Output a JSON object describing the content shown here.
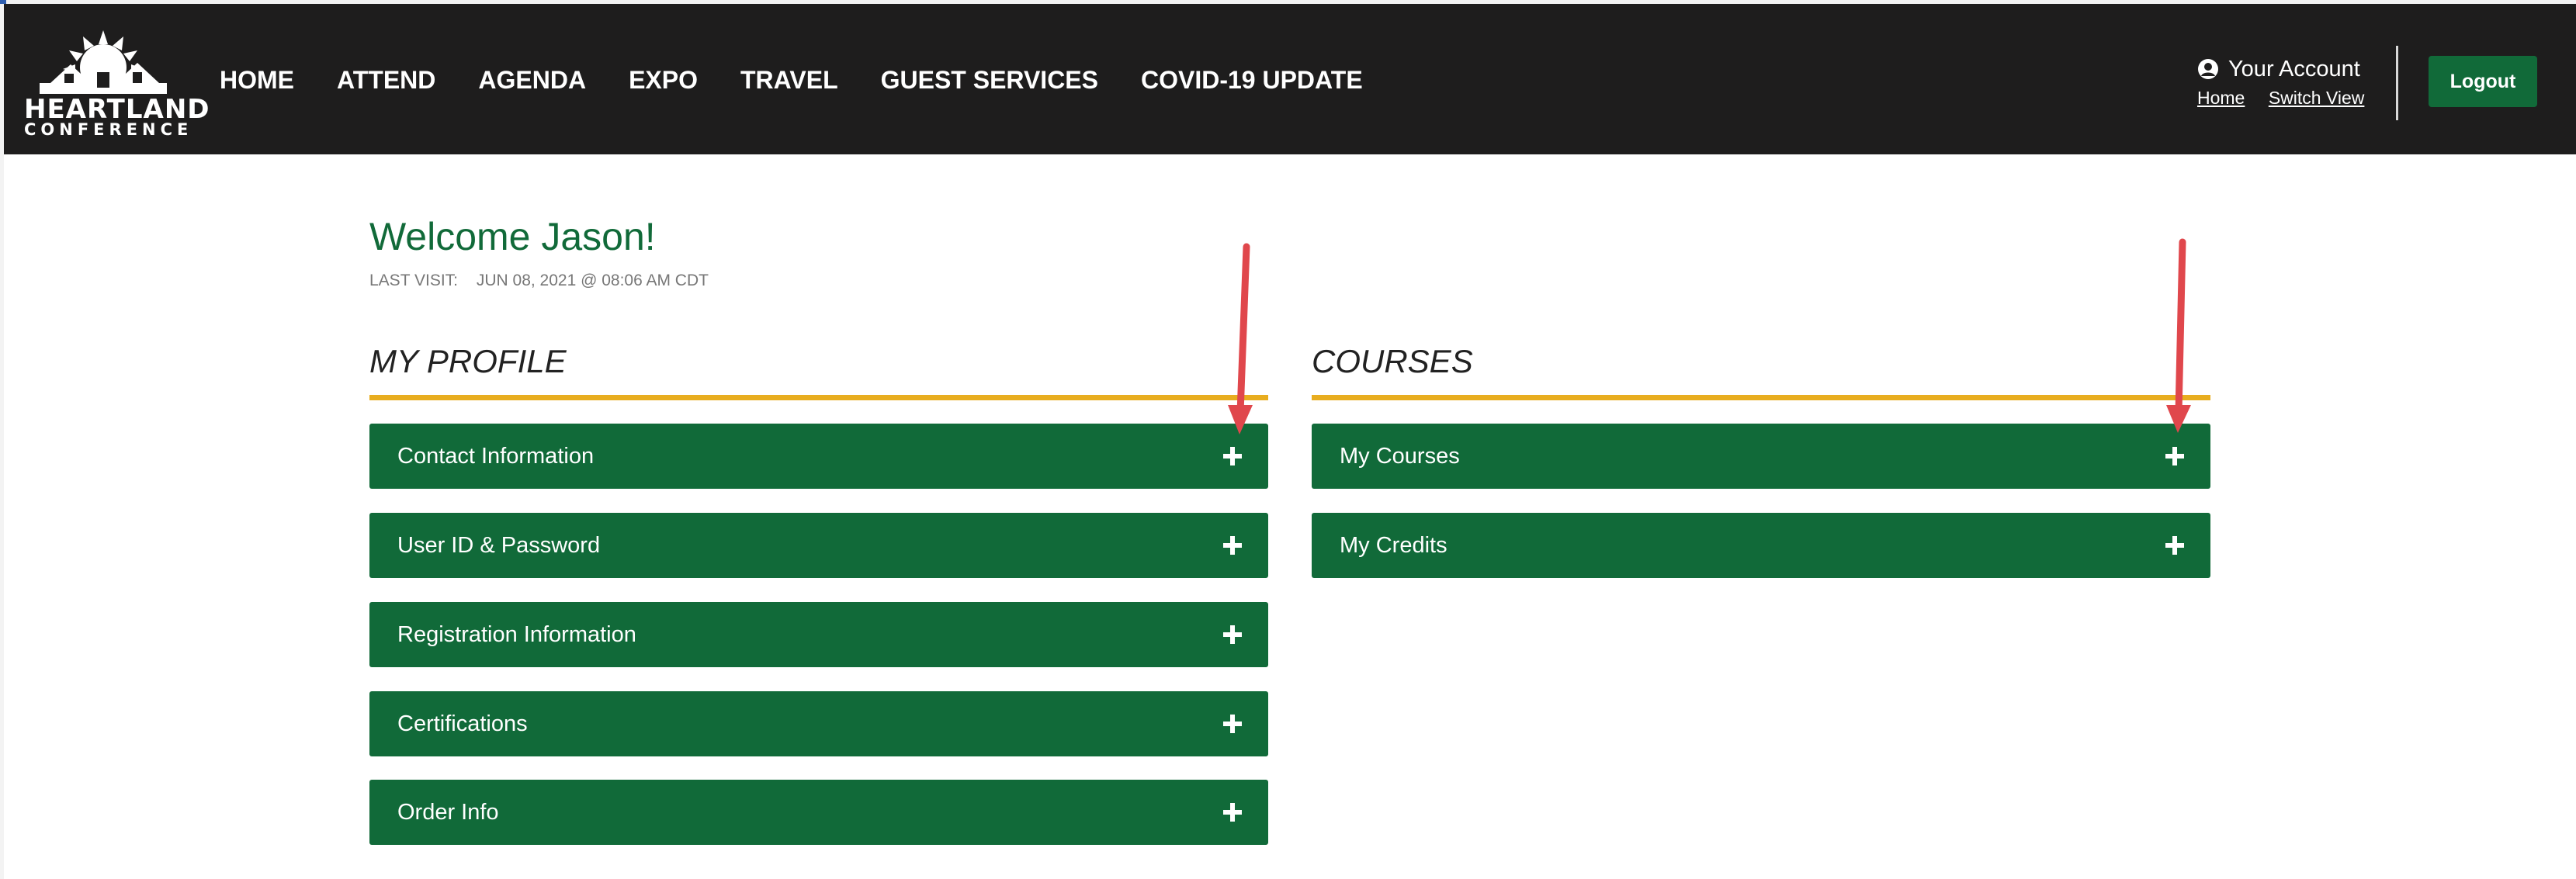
{
  "logo": {
    "line1": "HEARTLAND",
    "line2": "CONFERENCE"
  },
  "nav": [
    "HOME",
    "ATTEND",
    "AGENDA",
    "EXPO",
    "TRAVEL",
    "GUEST SERVICES",
    "COVID-19 UPDATE"
  ],
  "account": {
    "title": "Your Account",
    "links": [
      "Home",
      "Switch View"
    ],
    "logout": "Logout"
  },
  "welcome": {
    "title": "Welcome Jason!",
    "last_visit_label": "LAST VISIT:",
    "last_visit_value": "JUN 08, 2021 @ 08:06 AM CDT"
  },
  "profile": {
    "title": "MY PROFILE",
    "items": [
      "Contact Information",
      "User ID & Password",
      "Registration Information",
      "Certifications",
      "Order Info"
    ]
  },
  "courses": {
    "title": "COURSES",
    "items": [
      "My Courses",
      "My Credits"
    ]
  },
  "colors": {
    "header_bg": "#1e1d1d",
    "brand_green": "#116a39",
    "accent_gold": "#e8ad1f",
    "annotation_red": "#e0474c"
  }
}
